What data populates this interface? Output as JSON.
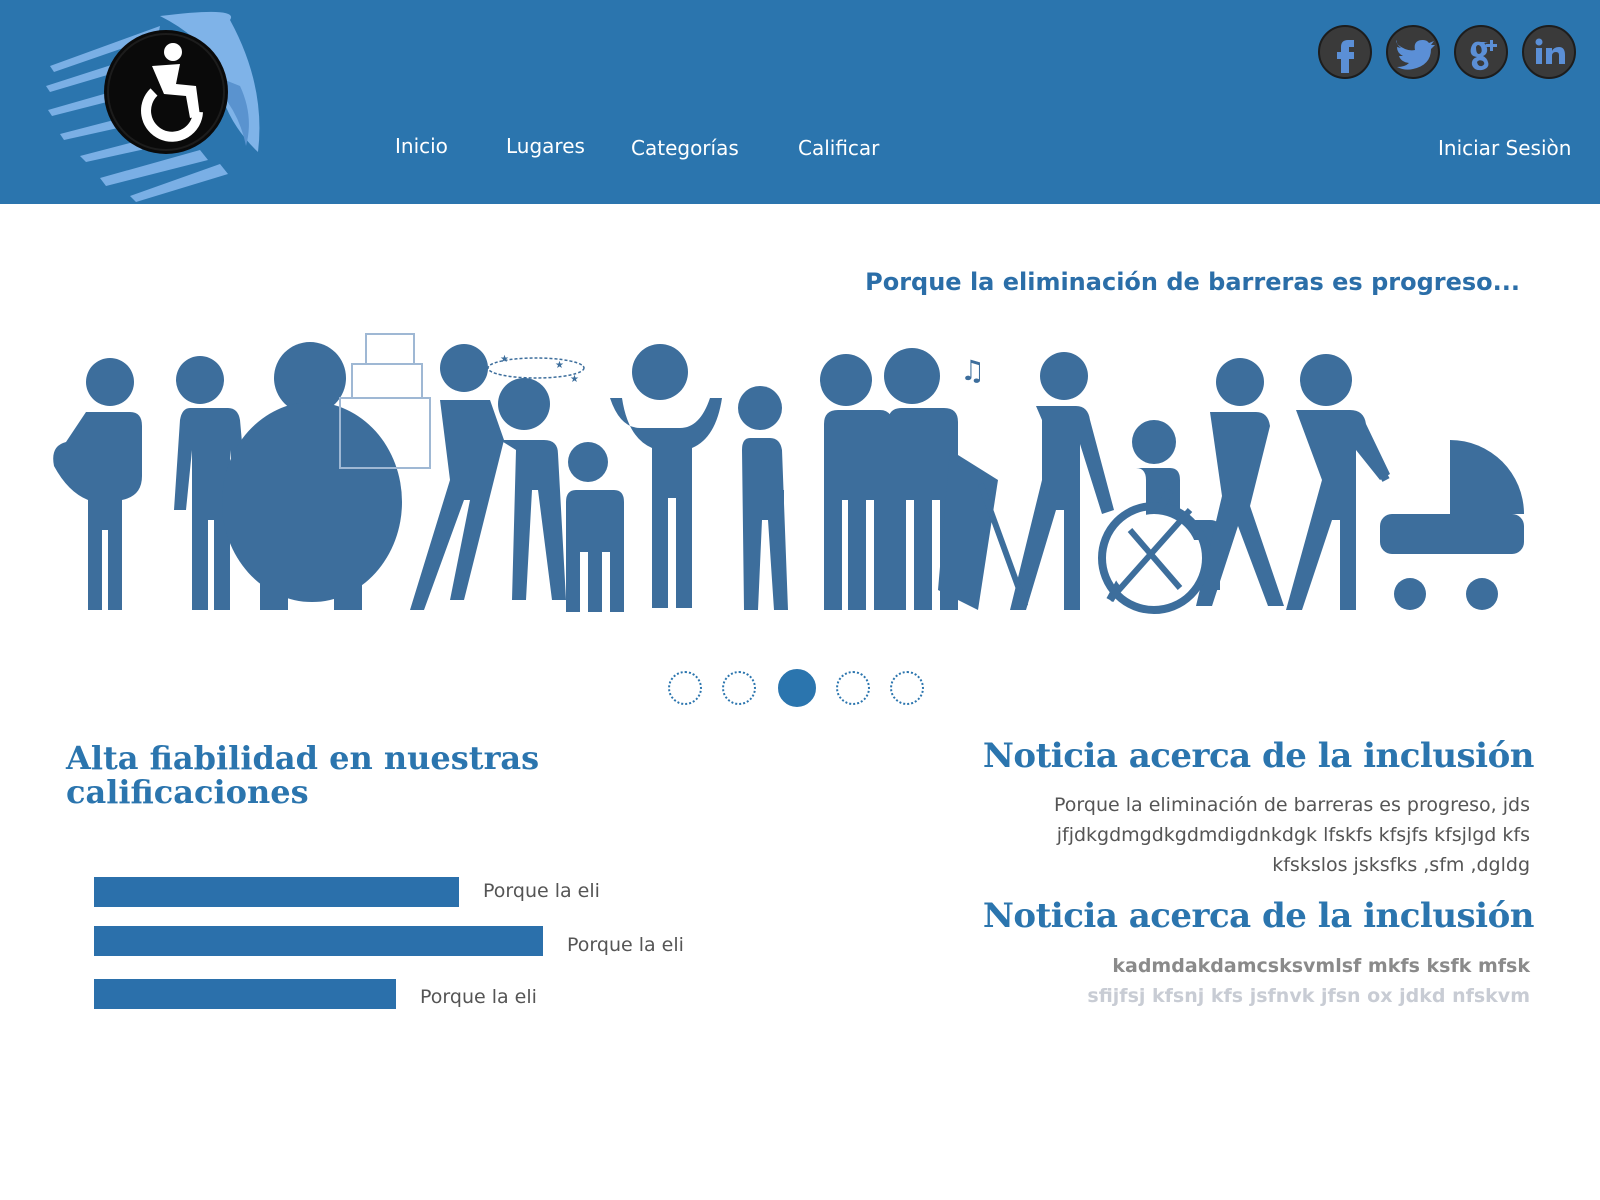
{
  "colors": {
    "brand_blue": "#2b75ae",
    "figure_blue": "#3d6e9c",
    "text_gray": "#555555"
  },
  "logo": {
    "icon": "wheelchair-accessibility-icon"
  },
  "nav": {
    "items": [
      {
        "label": "Inicio"
      },
      {
        "label": "Lugares"
      },
      {
        "label": "Categorías"
      },
      {
        "label": "Calificar"
      }
    ],
    "login_label": "Iniciar Sesiòn"
  },
  "social": [
    {
      "icon": "facebook-icon"
    },
    {
      "icon": "twitter-icon"
    },
    {
      "icon": "google-plus-icon"
    },
    {
      "icon": "linkedin-icon"
    }
  ],
  "hero": {
    "tagline": "Porque la eliminación de barreras es progreso...",
    "image": "diverse-people-disabilities-illustration",
    "slides_count": 5,
    "active_slide": 3
  },
  "ratings": {
    "title_line1": "Alta fiabilidad en nuestras",
    "title_line2": "calificaciones",
    "items": [
      {
        "label": "Porque la eli",
        "level": 0.435
      },
      {
        "label": "Porque la eli",
        "level": 0.535
      },
      {
        "label": "Porque la eli",
        "level": 0.36
      }
    ]
  },
  "news": [
    {
      "title": "Noticia acerca de la inclusión",
      "body_line1": "Porque la eliminación de barreras es progreso, jds",
      "body_line2": "jfjdkgdmgdkgdmdigdnkdgk lfskfs kfsjfs kfsjlgd kfs",
      "body_line3": "kfskslos jsksfks ,sfm ,dgldg"
    },
    {
      "title": "Noticia acerca de la inclusión",
      "body_line1": "kadmdakdamcsksvmlsf mkfs ksfk mfsk",
      "body_line2": "sfijfsj kfsnj kfs jsfnvk jfsn ox jdkd nfskvm"
    }
  ]
}
